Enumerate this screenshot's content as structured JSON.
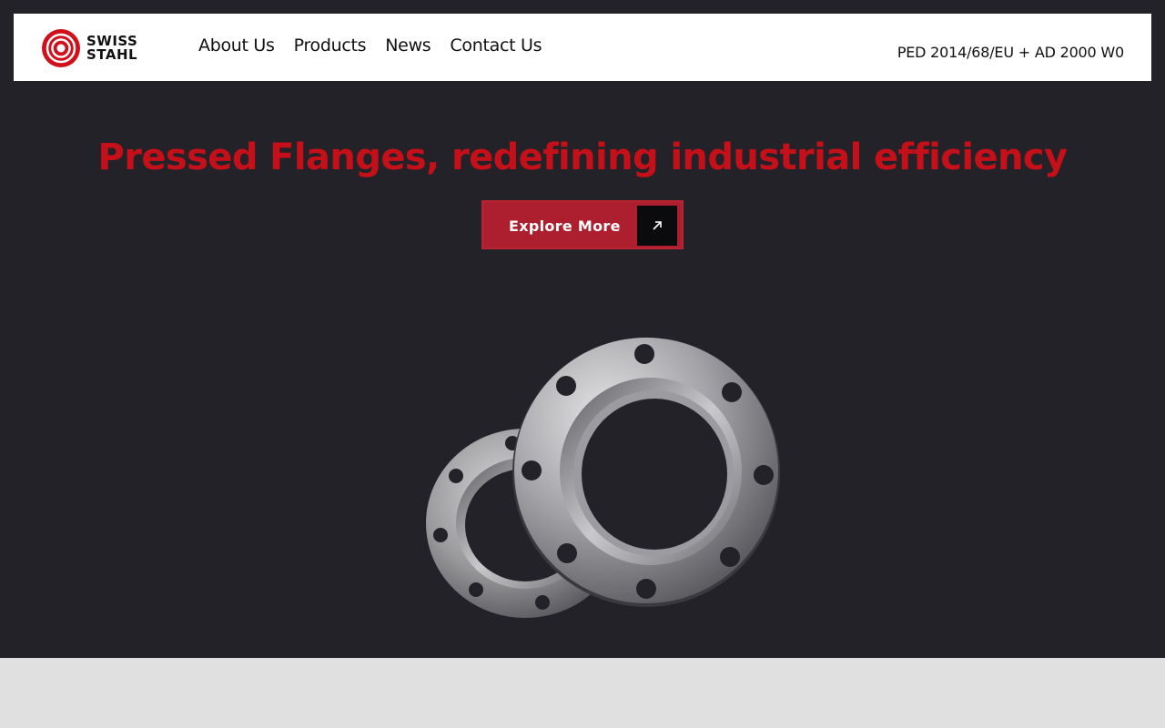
{
  "brand": {
    "line1": "SWISS",
    "line2": "STAHL",
    "accent_color": "#c5101a"
  },
  "nav": {
    "items": [
      {
        "label": "About Us"
      },
      {
        "label": "Products"
      },
      {
        "label": "News"
      },
      {
        "label": "Contact Us"
      }
    ],
    "certification": "PED 2014/68/EU + AD 2000 W0"
  },
  "hero": {
    "title": "Pressed Flanges, redefining industrial efficiency",
    "cta_label": "Explore More",
    "cta_icon": "arrow-up-right-icon",
    "background_color": "#232228",
    "title_color": "#c5101a",
    "button_color": "#ad1f2e"
  }
}
